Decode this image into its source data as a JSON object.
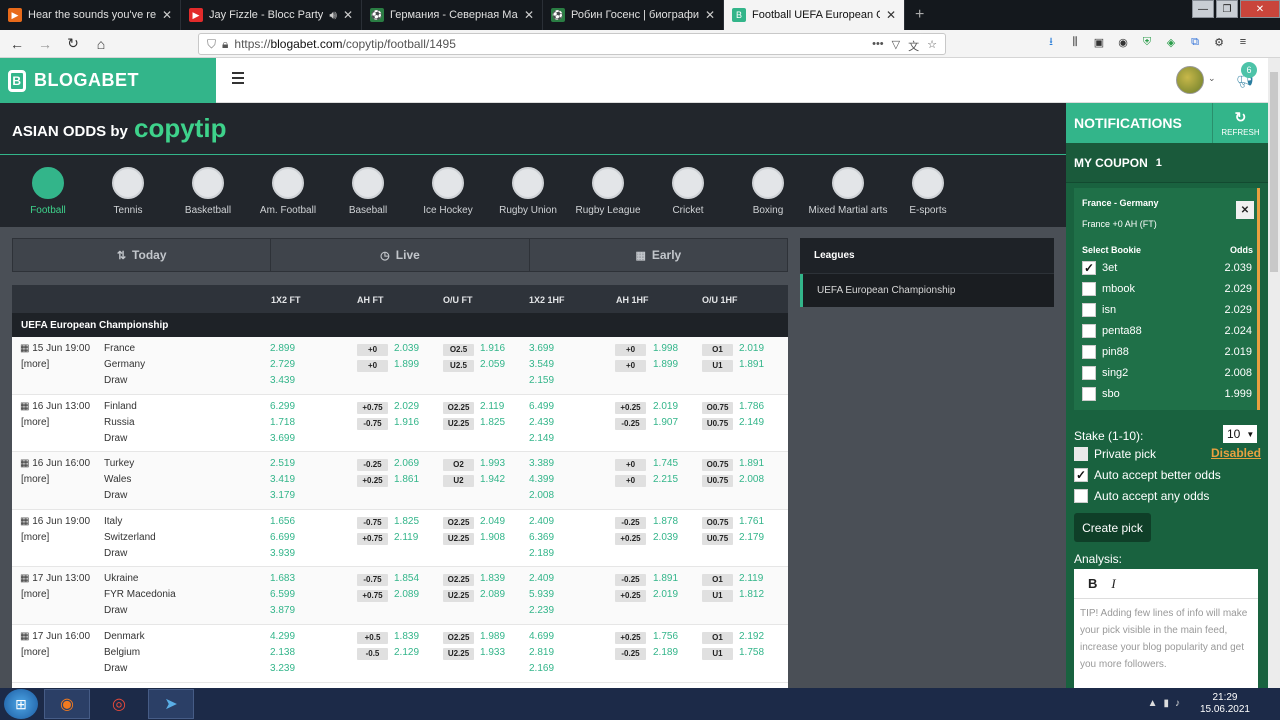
{
  "browser": {
    "tabs": [
      {
        "title": "Hear the sounds you've recent",
        "fav": "▶",
        "color": "#e86a1a"
      },
      {
        "title": "Jay Fizzle - Blocc Party (Offi",
        "fav": "▶",
        "color": "#e22b2b"
      },
      {
        "title": "Германия - Северная Македо",
        "fav": "⚽",
        "color": "#2a7d43"
      },
      {
        "title": "Робин Госенс | биография, ф",
        "fav": "⚽",
        "color": "#2a7d43"
      },
      {
        "title": "Football UEFA European Champ",
        "fav": "B",
        "color": "#33b58a"
      }
    ],
    "url_prefix": "https://",
    "url_host": "blogabet.com",
    "url_path": "/copytip/football/1495"
  },
  "site": {
    "logo_text": "BLOGABET",
    "notif_count": "6"
  },
  "copytip": {
    "title": "ASIAN ODDS by",
    "brand": "copytip"
  },
  "sports": [
    "Football",
    "Tennis",
    "Basketball",
    "Am. Football",
    "Baseball",
    "Ice Hockey",
    "Rugby Union",
    "Rugby League",
    "Cricket",
    "Boxing",
    "Mixed Martial arts",
    "E-sports"
  ],
  "modes": [
    {
      "icon": "⇅",
      "label": "Today"
    },
    {
      "icon": "◷",
      "label": "Live"
    },
    {
      "icon": "▦",
      "label": "Early"
    }
  ],
  "table": {
    "headers": [
      "1X2 FT",
      "AH FT",
      "O/U FT",
      "1X2 1HF",
      "AH 1HF",
      "O/U 1HF"
    ],
    "league": "UEFA European Championship",
    "more": "[more]",
    "matches": [
      {
        "date": "15 Jun 19:00",
        "home": "France",
        "away": "Germany",
        "draw": "Draw",
        "x12": [
          "2.899",
          "2.729",
          "3.439"
        ],
        "ahft": [
          [
            "+0",
            "2.039"
          ],
          [
            "+0",
            "1.899"
          ]
        ],
        "ouft": [
          [
            "O2.5",
            "1.916"
          ],
          [
            "U2.5",
            "2.059"
          ]
        ],
        "x12h": [
          "3.699",
          "3.549",
          "2.159"
        ],
        "ahh": [
          [
            "+0",
            "1.998"
          ],
          [
            "+0",
            "1.899"
          ]
        ],
        "ouh": [
          [
            "O1",
            "2.019"
          ],
          [
            "U1",
            "1.891"
          ]
        ]
      },
      {
        "date": "16 Jun 13:00",
        "home": "Finland",
        "away": "Russia",
        "draw": "Draw",
        "x12": [
          "6.299",
          "1.718",
          "3.699"
        ],
        "ahft": [
          [
            "+0.75",
            "2.029"
          ],
          [
            "-0.75",
            "1.916"
          ]
        ],
        "ouft": [
          [
            "O2.25",
            "2.119"
          ],
          [
            "U2.25",
            "1.825"
          ]
        ],
        "x12h": [
          "6.499",
          "2.439",
          "2.149"
        ],
        "ahh": [
          [
            "+0.25",
            "2.019"
          ],
          [
            "-0.25",
            "1.907"
          ]
        ],
        "ouh": [
          [
            "O0.75",
            "1.786"
          ],
          [
            "U0.75",
            "2.149"
          ]
        ]
      },
      {
        "date": "16 Jun 16:00",
        "home": "Turkey",
        "away": "Wales",
        "draw": "Draw",
        "x12": [
          "2.519",
          "3.419",
          "3.179"
        ],
        "ahft": [
          [
            "-0.25",
            "2.069"
          ],
          [
            "+0.25",
            "1.861"
          ]
        ],
        "ouft": [
          [
            "O2",
            "1.993"
          ],
          [
            "U2",
            "1.942"
          ]
        ],
        "x12h": [
          "3.389",
          "4.399",
          "2.008"
        ],
        "ahh": [
          [
            "+0",
            "1.745"
          ],
          [
            "+0",
            "2.215"
          ]
        ],
        "ouh": [
          [
            "O0.75",
            "1.891"
          ],
          [
            "U0.75",
            "2.008"
          ]
        ]
      },
      {
        "date": "16 Jun 19:00",
        "home": "Italy",
        "away": "Switzerland",
        "draw": "Draw",
        "x12": [
          "1.656",
          "6.699",
          "3.939"
        ],
        "ahft": [
          [
            "-0.75",
            "1.825"
          ],
          [
            "+0.75",
            "2.119"
          ]
        ],
        "ouft": [
          [
            "O2.25",
            "2.049"
          ],
          [
            "U2.25",
            "1.908"
          ]
        ],
        "x12h": [
          "2.409",
          "6.369",
          "2.189"
        ],
        "ahh": [
          [
            "-0.25",
            "1.878"
          ],
          [
            "+0.25",
            "2.039"
          ]
        ],
        "ouh": [
          [
            "O0.75",
            "1.761"
          ],
          [
            "U0.75",
            "2.179"
          ]
        ]
      },
      {
        "date": "17 Jun 13:00",
        "home": "Ukraine",
        "away": "FYR Macedonia",
        "draw": "Draw",
        "x12": [
          "1.683",
          "6.599",
          "3.879"
        ],
        "ahft": [
          [
            "-0.75",
            "1.854"
          ],
          [
            "+0.75",
            "2.089"
          ]
        ],
        "ouft": [
          [
            "O2.25",
            "1.839"
          ],
          [
            "U2.25",
            "2.089"
          ]
        ],
        "x12h": [
          "2.409",
          "5.939",
          "2.239"
        ],
        "ahh": [
          [
            "-0.25",
            "1.891"
          ],
          [
            "+0.25",
            "2.019"
          ]
        ],
        "ouh": [
          [
            "O1",
            "2.119"
          ],
          [
            "U1",
            "1.812"
          ]
        ]
      },
      {
        "date": "17 Jun 16:00",
        "home": "Denmark",
        "away": "Belgium",
        "draw": "Draw",
        "x12": [
          "4.299",
          "2.138",
          "3.239"
        ],
        "ahft": [
          [
            "+0.5",
            "1.839"
          ],
          [
            "-0.5",
            "2.129"
          ]
        ],
        "ouft": [
          [
            "O2.25",
            "1.989"
          ],
          [
            "U2.25",
            "1.933"
          ]
        ],
        "x12h": [
          "4.699",
          "2.819",
          "2.169"
        ],
        "ahh": [
          [
            "+0.25",
            "1.756"
          ],
          [
            "-0.25",
            "2.189"
          ]
        ],
        "ouh": [
          [
            "O1",
            "2.192"
          ],
          [
            "U1",
            "1.758"
          ]
        ]
      }
    ]
  },
  "leagues": {
    "title": "Leagues",
    "items": [
      "UEFA European Championship"
    ]
  },
  "sidebar": {
    "notifications": "NOTIFICATIONS",
    "refresh": "REFRESH",
    "my_coupon": "MY COUPON",
    "coupon_count": "1",
    "match": "France - Germany",
    "pick": "France +0 AH (FT)",
    "select_bookie": "Select Bookie",
    "odds": "Odds",
    "bookies": [
      {
        "name": "3et",
        "odds": "2.039",
        "checked": true
      },
      {
        "name": "mbook",
        "odds": "2.029",
        "checked": false
      },
      {
        "name": "isn",
        "odds": "2.029",
        "checked": false
      },
      {
        "name": "penta88",
        "odds": "2.024",
        "checked": false
      },
      {
        "name": "pin88",
        "odds": "2.019",
        "checked": false
      },
      {
        "name": "sing2",
        "odds": "2.008",
        "checked": false
      },
      {
        "name": "sbo",
        "odds": "1.999",
        "checked": false
      }
    ],
    "stake_label": "Stake (1-10):",
    "stake_value": "10",
    "private_pick": "Private pick",
    "disabled": "Disabled",
    "auto_better": "Auto accept better odds",
    "auto_any": "Auto accept any odds",
    "create_pick": "Create pick",
    "analysis": "Analysis:",
    "tip": "TIP! Adding few lines of info will make your pick visible in the main feed, increase your blog popularity and get you more followers."
  },
  "taskbar": {
    "time": "21:29",
    "date": "15.06.2021"
  }
}
